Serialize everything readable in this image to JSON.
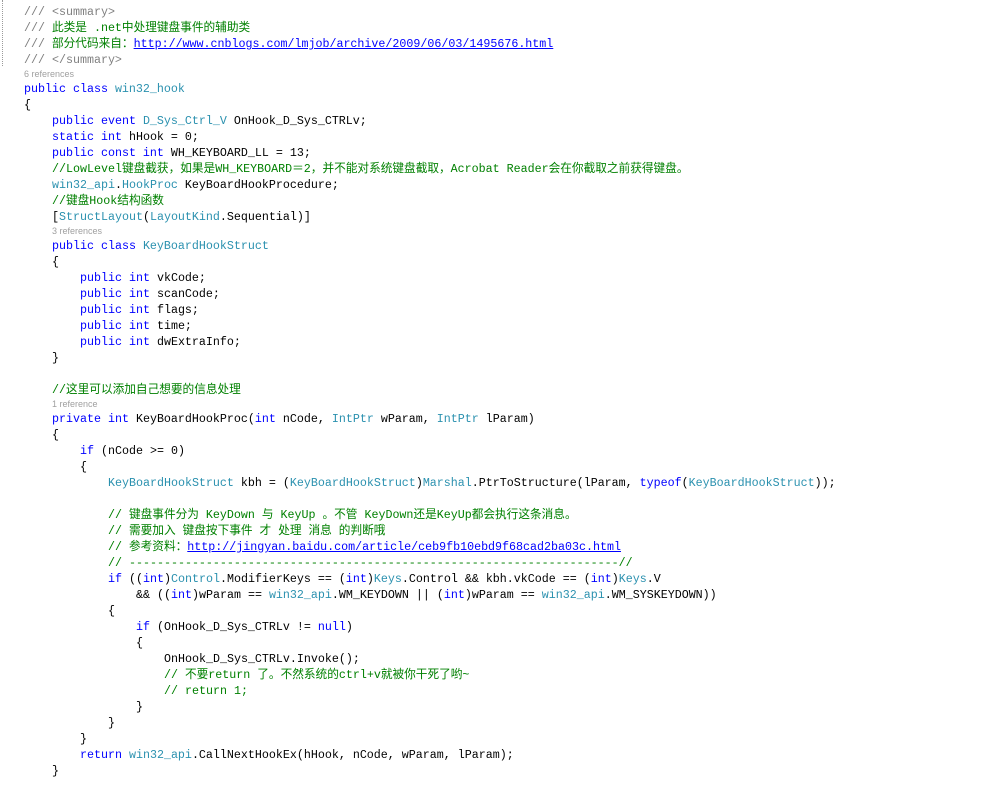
{
  "syntax_colors": {
    "keyword": "#0000ff",
    "type": "#2b91af",
    "text": "#000000",
    "comment": "#008000",
    "doc": "#808080",
    "link": "#0000ff",
    "codelens": "#a0a0a0"
  },
  "code": {
    "lines": [
      {
        "depth": 0,
        "tokens": [
          {
            "t": "/// <summary>",
            "c": "doc"
          }
        ]
      },
      {
        "depth": 0,
        "tokens": [
          {
            "t": "/// ",
            "c": "doc"
          },
          {
            "t": "此类是 .net中处理键盘事件的辅助类",
            "c": "comment"
          }
        ]
      },
      {
        "depth": 0,
        "tokens": [
          {
            "t": "/// ",
            "c": "doc"
          },
          {
            "t": "部分代码来自：",
            "c": "comment"
          },
          {
            "t": "http://www.cnblogs.com/lmjob/archive/2009/06/03/1495676.html",
            "c": "link"
          }
        ]
      },
      {
        "depth": 0,
        "tokens": [
          {
            "t": "/// </summary>",
            "c": "doc"
          }
        ]
      },
      {
        "depth": 0,
        "lens": "6 references"
      },
      {
        "depth": 0,
        "tokens": [
          {
            "t": "public class ",
            "c": "keyword"
          },
          {
            "t": "win32_hook",
            "c": "type"
          }
        ]
      },
      {
        "depth": 0,
        "tokens": [
          {
            "t": "{",
            "c": "text"
          }
        ]
      },
      {
        "depth": 1,
        "tokens": [
          {
            "t": "public event ",
            "c": "keyword"
          },
          {
            "t": "D_Sys_Ctrl_V",
            "c": "type"
          },
          {
            "t": " OnHook_D_Sys_CTRLv;",
            "c": "text"
          }
        ]
      },
      {
        "depth": 1,
        "tokens": [
          {
            "t": "static int ",
            "c": "keyword"
          },
          {
            "t": "hHook = 0;",
            "c": "text"
          }
        ]
      },
      {
        "depth": 1,
        "tokens": [
          {
            "t": "public const int ",
            "c": "keyword"
          },
          {
            "t": "WH_KEYBOARD_LL = 13;",
            "c": "text"
          }
        ]
      },
      {
        "depth": 1,
        "tokens": [
          {
            "t": "//LowLevel键盘截获，如果是WH_KEYBOARD＝2，并不能对系统键盘截取，Acrobat Reader会在你截取之前获得键盘。",
            "c": "comment"
          }
        ]
      },
      {
        "depth": 1,
        "tokens": [
          {
            "t": "win32_api",
            "c": "type"
          },
          {
            "t": ".",
            "c": "text"
          },
          {
            "t": "HookProc",
            "c": "type"
          },
          {
            "t": " KeyBoardHookProcedure;",
            "c": "text"
          }
        ]
      },
      {
        "depth": 1,
        "tokens": [
          {
            "t": "//键盘Hook结构函数",
            "c": "comment"
          }
        ]
      },
      {
        "depth": 1,
        "tokens": [
          {
            "t": "[",
            "c": "text"
          },
          {
            "t": "StructLayout",
            "c": "type"
          },
          {
            "t": "(",
            "c": "text"
          },
          {
            "t": "LayoutKind",
            "c": "type"
          },
          {
            "t": ".Sequential)]",
            "c": "text"
          }
        ]
      },
      {
        "depth": 1,
        "lens": "3 references"
      },
      {
        "depth": 1,
        "tokens": [
          {
            "t": "public class ",
            "c": "keyword"
          },
          {
            "t": "KeyBoardHookStruct",
            "c": "type"
          }
        ]
      },
      {
        "depth": 1,
        "tokens": [
          {
            "t": "{",
            "c": "text"
          }
        ]
      },
      {
        "depth": 2,
        "tokens": [
          {
            "t": "public int ",
            "c": "keyword"
          },
          {
            "t": "vkCode;",
            "c": "text"
          }
        ]
      },
      {
        "depth": 2,
        "tokens": [
          {
            "t": "public int ",
            "c": "keyword"
          },
          {
            "t": "scanCode;",
            "c": "text"
          }
        ]
      },
      {
        "depth": 2,
        "tokens": [
          {
            "t": "public int ",
            "c": "keyword"
          },
          {
            "t": "flags;",
            "c": "text"
          }
        ]
      },
      {
        "depth": 2,
        "tokens": [
          {
            "t": "public int ",
            "c": "keyword"
          },
          {
            "t": "time;",
            "c": "text"
          }
        ]
      },
      {
        "depth": 2,
        "tokens": [
          {
            "t": "public int ",
            "c": "keyword"
          },
          {
            "t": "dwExtraInfo;",
            "c": "text"
          }
        ]
      },
      {
        "depth": 1,
        "tokens": [
          {
            "t": "}",
            "c": "text"
          }
        ]
      },
      {
        "depth": 0,
        "tokens": []
      },
      {
        "depth": 1,
        "tokens": [
          {
            "t": "//这里可以添加自己想要的信息处理",
            "c": "comment"
          }
        ]
      },
      {
        "depth": 1,
        "lens": "1 reference"
      },
      {
        "depth": 1,
        "tokens": [
          {
            "t": "private int ",
            "c": "keyword"
          },
          {
            "t": "KeyBoardHookProc(",
            "c": "text"
          },
          {
            "t": "int",
            "c": "keyword"
          },
          {
            "t": " nCode, ",
            "c": "text"
          },
          {
            "t": "IntPtr",
            "c": "type"
          },
          {
            "t": " wParam, ",
            "c": "text"
          },
          {
            "t": "IntPtr",
            "c": "type"
          },
          {
            "t": " lParam)",
            "c": "text"
          }
        ]
      },
      {
        "depth": 1,
        "tokens": [
          {
            "t": "{",
            "c": "text"
          }
        ]
      },
      {
        "depth": 2,
        "tokens": [
          {
            "t": "if",
            "c": "keyword"
          },
          {
            "t": " (nCode >= 0)",
            "c": "text"
          }
        ]
      },
      {
        "depth": 2,
        "tokens": [
          {
            "t": "{",
            "c": "text"
          }
        ]
      },
      {
        "depth": 3,
        "tokens": [
          {
            "t": "KeyBoardHookStruct",
            "c": "type"
          },
          {
            "t": " kbh = (",
            "c": "text"
          },
          {
            "t": "KeyBoardHookStruct",
            "c": "type"
          },
          {
            "t": ")",
            "c": "text"
          },
          {
            "t": "Marshal",
            "c": "type"
          },
          {
            "t": ".PtrToStructure(lParam, ",
            "c": "text"
          },
          {
            "t": "typeof",
            "c": "keyword"
          },
          {
            "t": "(",
            "c": "text"
          },
          {
            "t": "KeyBoardHookStruct",
            "c": "type"
          },
          {
            "t": "));",
            "c": "text"
          }
        ]
      },
      {
        "depth": 0,
        "tokens": []
      },
      {
        "depth": 3,
        "tokens": [
          {
            "t": "// 键盘事件分为 KeyDown 与 KeyUp 。不管 KeyDown还是KeyUp都会执行这条消息。",
            "c": "comment"
          }
        ]
      },
      {
        "depth": 3,
        "tokens": [
          {
            "t": "// 需要加入 键盘按下事件 才 处理 消息 的判断哦",
            "c": "comment"
          }
        ]
      },
      {
        "depth": 3,
        "tokens": [
          {
            "t": "// 参考资料：",
            "c": "comment"
          },
          {
            "t": "http://jingyan.baidu.com/article/ceb9fb10ebd9f68cad2ba03c.html",
            "c": "link"
          }
        ]
      },
      {
        "depth": 3,
        "tokens": [
          {
            "t": "// ----------------------------------------------------------------------//",
            "c": "comment"
          }
        ]
      },
      {
        "depth": 3,
        "tokens": [
          {
            "t": "if",
            "c": "keyword"
          },
          {
            "t": " ((",
            "c": "text"
          },
          {
            "t": "int",
            "c": "keyword"
          },
          {
            "t": ")",
            "c": "text"
          },
          {
            "t": "Control",
            "c": "type"
          },
          {
            "t": ".ModifierKeys == (",
            "c": "text"
          },
          {
            "t": "int",
            "c": "keyword"
          },
          {
            "t": ")",
            "c": "text"
          },
          {
            "t": "Keys",
            "c": "type"
          },
          {
            "t": ".Control && kbh.vkCode == (",
            "c": "text"
          },
          {
            "t": "int",
            "c": "keyword"
          },
          {
            "t": ")",
            "c": "text"
          },
          {
            "t": "Keys",
            "c": "type"
          },
          {
            "t": ".V",
            "c": "text"
          }
        ]
      },
      {
        "depth": 4,
        "tokens": [
          {
            "t": "&& ((",
            "c": "text"
          },
          {
            "t": "int",
            "c": "keyword"
          },
          {
            "t": ")wParam == ",
            "c": "text"
          },
          {
            "t": "win32_api",
            "c": "type"
          },
          {
            "t": ".WM_KEYDOWN || (",
            "c": "text"
          },
          {
            "t": "int",
            "c": "keyword"
          },
          {
            "t": ")wParam == ",
            "c": "text"
          },
          {
            "t": "win32_api",
            "c": "type"
          },
          {
            "t": ".WM_SYSKEYDOWN))",
            "c": "text"
          }
        ]
      },
      {
        "depth": 3,
        "tokens": [
          {
            "t": "{",
            "c": "text"
          }
        ]
      },
      {
        "depth": 4,
        "tokens": [
          {
            "t": "if",
            "c": "keyword"
          },
          {
            "t": " (OnHook_D_Sys_CTRLv != ",
            "c": "text"
          },
          {
            "t": "null",
            "c": "keyword"
          },
          {
            "t": ")",
            "c": "text"
          }
        ]
      },
      {
        "depth": 4,
        "tokens": [
          {
            "t": "{",
            "c": "text"
          }
        ]
      },
      {
        "depth": 5,
        "tokens": [
          {
            "t": "OnHook_D_Sys_CTRLv.Invoke();",
            "c": "text"
          }
        ]
      },
      {
        "depth": 5,
        "tokens": [
          {
            "t": "// 不要return 了。不然系统的ctrl+v就被你干死了哟~",
            "c": "comment"
          }
        ]
      },
      {
        "depth": 5,
        "tokens": [
          {
            "t": "// return 1;",
            "c": "comment"
          }
        ]
      },
      {
        "depth": 4,
        "tokens": [
          {
            "t": "}",
            "c": "text"
          }
        ]
      },
      {
        "depth": 3,
        "tokens": [
          {
            "t": "}",
            "c": "text"
          }
        ]
      },
      {
        "depth": 2,
        "tokens": [
          {
            "t": "}",
            "c": "text"
          }
        ]
      },
      {
        "depth": 2,
        "tokens": [
          {
            "t": "return ",
            "c": "keyword"
          },
          {
            "t": "win32_api",
            "c": "type"
          },
          {
            "t": ".CallNextHookEx(hHook, nCode, wParam, lParam);",
            "c": "text"
          }
        ]
      },
      {
        "depth": 1,
        "tokens": [
          {
            "t": "}",
            "c": "text"
          }
        ]
      }
    ]
  }
}
